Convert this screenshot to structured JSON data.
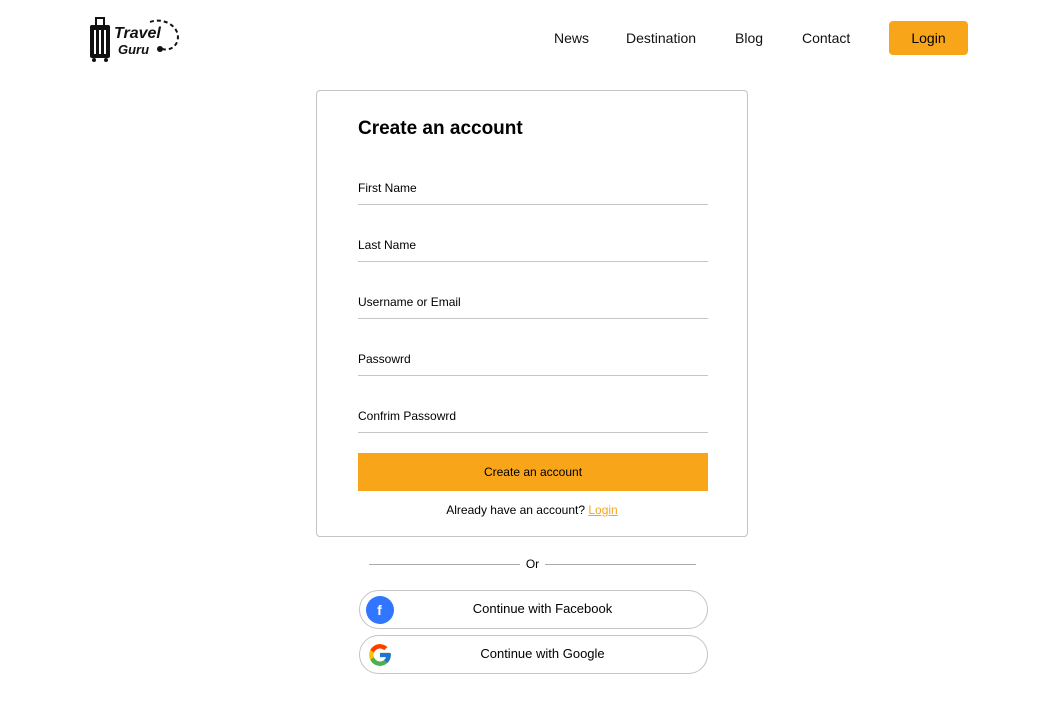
{
  "header": {
    "logo": {
      "line1": "Travel",
      "line2": "Guru"
    },
    "nav": [
      {
        "label": "News"
      },
      {
        "label": "Destination"
      },
      {
        "label": "Blog"
      },
      {
        "label": "Contact"
      }
    ],
    "login_label": "Login"
  },
  "form": {
    "title": "Create an account",
    "fields": [
      {
        "placeholder": "First Name"
      },
      {
        "placeholder": "Last Name"
      },
      {
        "placeholder": "Username or Email"
      },
      {
        "placeholder": "Passowrd"
      },
      {
        "placeholder": "Confrim Passowrd"
      }
    ],
    "submit_label": "Create an account",
    "already_text": "Already have an account?",
    "login_link": "Login"
  },
  "divider": {
    "text": "Or"
  },
  "social": {
    "facebook": {
      "label": "Continue with Facebook",
      "icon": "facebook-icon"
    },
    "google": {
      "label": "Continue with Google",
      "icon": "google-icon"
    }
  },
  "colors": {
    "accent": "#F9A51A",
    "facebook": "#3076FF",
    "border": "#C4C4C4"
  }
}
